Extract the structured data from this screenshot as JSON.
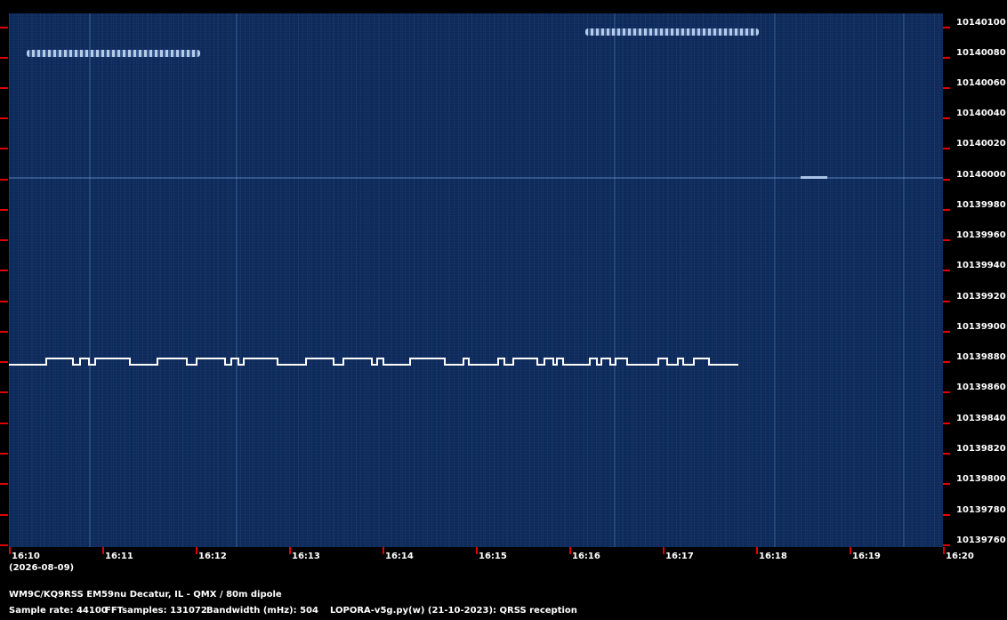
{
  "chart_data": {
    "type": "heatmap",
    "title": "",
    "x_tick_labels": [
      "16:10",
      "16:11",
      "16:12",
      "16:13",
      "16:14",
      "16:15",
      "16:16",
      "16:17",
      "16:18",
      "16:19",
      "16:20"
    ],
    "x_sub_label": "(2026-08-09)",
    "y_tick_labels": [
      "10140100",
      "10140080",
      "10140060",
      "10140040",
      "10140020",
      "10140000",
      "10139980",
      "10139960",
      "10139940",
      "10139920",
      "10139900",
      "10139880",
      "10139860",
      "10139840",
      "10139820",
      "10139800",
      "10139780",
      "10139760"
    ],
    "colors": {
      "background": "#0d2a5c",
      "signal": "#ffffff",
      "tick": "#e00000"
    }
  },
  "footer": {
    "station": "WM9C/KQ9RSS EM59nu Decatur, IL - QMX / 80m dipole",
    "sample_rate": "Sample rate: 44100",
    "fft_samples": "FFTsamples: 131072",
    "bandwidth": "Bandwidth (mHz): 504",
    "software": "LOPORA-v5g.py(w) (21-10-2023): QRSS reception"
  }
}
